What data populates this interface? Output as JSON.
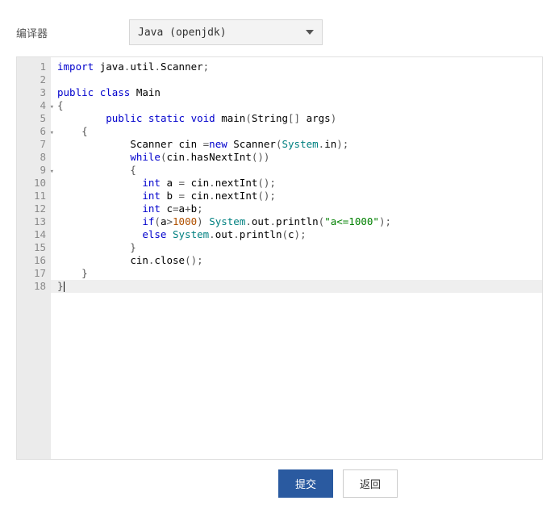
{
  "compiler": {
    "label": "编译器",
    "selected": "Java (openjdk)"
  },
  "code": {
    "lines": [
      {
        "n": 1,
        "fold": "",
        "tokens": [
          [
            "kw",
            "import"
          ],
          [
            "pun",
            " "
          ],
          [
            "pkg",
            "java"
          ],
          [
            "pun",
            "."
          ],
          [
            "pkg",
            "util"
          ],
          [
            "pun",
            "."
          ],
          [
            "cls",
            "Scanner"
          ],
          [
            "pun",
            ";"
          ]
        ]
      },
      {
        "n": 2,
        "fold": "",
        "tokens": []
      },
      {
        "n": 3,
        "fold": "",
        "tokens": [
          [
            "kw",
            "public"
          ],
          [
            "pun",
            " "
          ],
          [
            "kw",
            "class"
          ],
          [
            "pun",
            " "
          ],
          [
            "cls",
            "Main"
          ]
        ]
      },
      {
        "n": 4,
        "fold": "▾",
        "tokens": [
          [
            "pun",
            "{"
          ]
        ]
      },
      {
        "n": 5,
        "fold": "",
        "tokens": [
          [
            "pun",
            "        "
          ],
          [
            "kw",
            "public"
          ],
          [
            "pun",
            " "
          ],
          [
            "kw",
            "static"
          ],
          [
            "pun",
            " "
          ],
          [
            "kw",
            "void"
          ],
          [
            "pun",
            " "
          ],
          [
            "id",
            "main"
          ],
          [
            "pun",
            "("
          ],
          [
            "cls",
            "String"
          ],
          [
            "pun",
            "[] "
          ],
          [
            "id",
            "args"
          ],
          [
            "pun",
            ")"
          ]
        ]
      },
      {
        "n": 6,
        "fold": "▾",
        "tokens": [
          [
            "pun",
            "    {"
          ]
        ]
      },
      {
        "n": 7,
        "fold": "",
        "tokens": [
          [
            "pun",
            "            "
          ],
          [
            "cls",
            "Scanner"
          ],
          [
            "pun",
            " "
          ],
          [
            "id",
            "cin"
          ],
          [
            "pun",
            " ="
          ],
          [
            "kw",
            "new"
          ],
          [
            "pun",
            " "
          ],
          [
            "cls",
            "Scanner"
          ],
          [
            "pun",
            "("
          ],
          [
            "sys",
            "System"
          ],
          [
            "pun",
            "."
          ],
          [
            "id",
            "in"
          ],
          [
            "pun",
            ");"
          ]
        ]
      },
      {
        "n": 8,
        "fold": "",
        "tokens": [
          [
            "pun",
            "            "
          ],
          [
            "kw",
            "while"
          ],
          [
            "pun",
            "("
          ],
          [
            "id",
            "cin"
          ],
          [
            "pun",
            "."
          ],
          [
            "id",
            "hasNextInt"
          ],
          [
            "pun",
            "())"
          ]
        ]
      },
      {
        "n": 9,
        "fold": "▾",
        "tokens": [
          [
            "pun",
            "            {"
          ]
        ]
      },
      {
        "n": 10,
        "fold": "",
        "tokens": [
          [
            "pun",
            "              "
          ],
          [
            "kw",
            "int"
          ],
          [
            "pun",
            " "
          ],
          [
            "id",
            "a"
          ],
          [
            "pun",
            " = "
          ],
          [
            "id",
            "cin"
          ],
          [
            "pun",
            "."
          ],
          [
            "id",
            "nextInt"
          ],
          [
            "pun",
            "();"
          ]
        ]
      },
      {
        "n": 11,
        "fold": "",
        "tokens": [
          [
            "pun",
            "              "
          ],
          [
            "kw",
            "int"
          ],
          [
            "pun",
            " "
          ],
          [
            "id",
            "b"
          ],
          [
            "pun",
            " = "
          ],
          [
            "id",
            "cin"
          ],
          [
            "pun",
            "."
          ],
          [
            "id",
            "nextInt"
          ],
          [
            "pun",
            "();"
          ]
        ]
      },
      {
        "n": 12,
        "fold": "",
        "tokens": [
          [
            "pun",
            "              "
          ],
          [
            "kw",
            "int"
          ],
          [
            "pun",
            " "
          ],
          [
            "id",
            "c"
          ],
          [
            "pun",
            "="
          ],
          [
            "id",
            "a"
          ],
          [
            "pun",
            "+"
          ],
          [
            "id",
            "b"
          ],
          [
            "pun",
            ";"
          ]
        ]
      },
      {
        "n": 13,
        "fold": "",
        "tokens": [
          [
            "pun",
            "              "
          ],
          [
            "kw",
            "if"
          ],
          [
            "pun",
            "("
          ],
          [
            "id",
            "a"
          ],
          [
            "pun",
            ">"
          ],
          [
            "num",
            "1000"
          ],
          [
            "pun",
            ") "
          ],
          [
            "sys",
            "System"
          ],
          [
            "pun",
            "."
          ],
          [
            "id",
            "out"
          ],
          [
            "pun",
            "."
          ],
          [
            "id",
            "println"
          ],
          [
            "pun",
            "("
          ],
          [
            "str",
            "\"a<=1000\""
          ],
          [
            "pun",
            ");"
          ]
        ]
      },
      {
        "n": 14,
        "fold": "",
        "tokens": [
          [
            "pun",
            "              "
          ],
          [
            "kw",
            "else"
          ],
          [
            "pun",
            " "
          ],
          [
            "sys",
            "System"
          ],
          [
            "pun",
            "."
          ],
          [
            "id",
            "out"
          ],
          [
            "pun",
            "."
          ],
          [
            "id",
            "println"
          ],
          [
            "pun",
            "("
          ],
          [
            "id",
            "c"
          ],
          [
            "pun",
            ");"
          ]
        ]
      },
      {
        "n": 15,
        "fold": "",
        "tokens": [
          [
            "pun",
            "            }"
          ]
        ]
      },
      {
        "n": 16,
        "fold": "",
        "tokens": [
          [
            "pun",
            "            "
          ],
          [
            "id",
            "cin"
          ],
          [
            "pun",
            "."
          ],
          [
            "id",
            "close"
          ],
          [
            "pun",
            "();"
          ]
        ]
      },
      {
        "n": 17,
        "fold": "",
        "tokens": [
          [
            "pun",
            "    }"
          ]
        ]
      },
      {
        "n": 18,
        "fold": "",
        "tokens": [
          [
            "pun",
            "}"
          ]
        ],
        "active": true
      }
    ]
  },
  "buttons": {
    "submit": "提交",
    "back": "返回"
  }
}
